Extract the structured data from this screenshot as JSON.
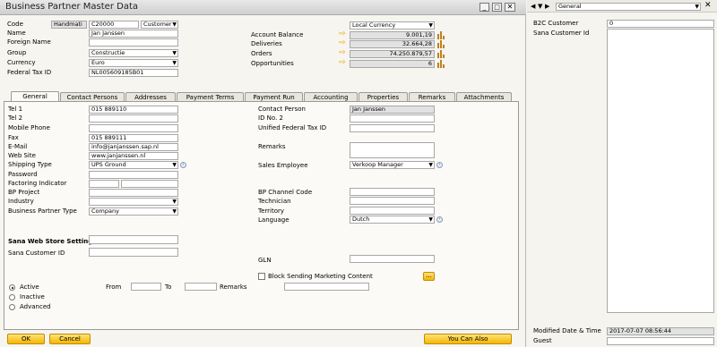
{
  "window": {
    "title": "Business Partner Master Data"
  },
  "header": {
    "code_label": "Code",
    "code_series": "Handmati",
    "code_value": "C20000",
    "code_type": "Customer",
    "name_label": "Name",
    "name_value": "Jan Janssen",
    "foreign_name_label": "Foreign Name",
    "foreign_name_value": "",
    "group_label": "Group",
    "group_value": "Constructie",
    "currency_label": "Currency",
    "currency_value": "Euro",
    "federal_tax_label": "Federal Tax ID",
    "federal_tax_value": "NL005609185B01",
    "local_currency": "Local Currency",
    "balance_label": "Account Balance",
    "balance_value": "9.001,19",
    "deliveries_label": "Deliveries",
    "deliveries_value": "32.664,28",
    "orders_label": "Orders",
    "orders_value": "74.250.879,57",
    "opportunities_label": "Opportunities",
    "opportunities_value": "6"
  },
  "tabs": [
    "General",
    "Contact Persons",
    "Addresses",
    "Payment Terms",
    "Payment Run",
    "Accounting",
    "Properties",
    "Remarks",
    "Attachments"
  ],
  "general": {
    "tel1_label": "Tel 1",
    "tel1_value": "015 889110",
    "tel2_label": "Tel 2",
    "tel2_value": "",
    "mobile_label": "Mobile Phone",
    "mobile_value": "",
    "fax_label": "Fax",
    "fax_value": "015 889111",
    "email_label": "E-Mail",
    "email_value": "info@janjanssen.sap.nl",
    "website_label": "Web Site",
    "website_value": "www.janjanssen.nl",
    "shipping_label": "Shipping Type",
    "shipping_value": "UPS Ground",
    "password_label": "Password",
    "password_value": "",
    "factoring_label": "Factoring Indicator",
    "bp_project_label": "BP Project",
    "industry_label": "Industry",
    "bp_type_label": "Business Partner Type",
    "bp_type_value": "Company",
    "contact_person_label": "Contact Person",
    "contact_person_value": "Jan Janssen",
    "id_no2_label": "ID No. 2",
    "unified_tax_label": "Unified Federal Tax ID",
    "remarks_label": "Remarks",
    "sales_employee_label": "Sales Employee",
    "sales_employee_value": "Verkoop Manager",
    "bp_channel_label": "BP Channel Code",
    "technician_label": "Technician",
    "territory_label": "Territory",
    "language_label": "Language",
    "language_value": "Dutch",
    "sana_web_label": "Sana Web Store Settings",
    "sana_customer_label": "Sana Customer ID",
    "gln_label": "GLN",
    "block_label": "Block Sending Marketing Content",
    "active_label": "Active",
    "inactive_label": "Inactive",
    "advanced_label": "Advanced",
    "from_label": "From",
    "to_label": "To",
    "remarks2_label": "Remarks",
    "ellipsis": "..."
  },
  "buttons": {
    "ok": "OK",
    "cancel": "Cancel",
    "you_can_also": "You Can Also"
  },
  "side_panel": {
    "select_value": "General",
    "b2c_label": "B2C Customer",
    "b2c_value": "0",
    "sana_id_label": "Sana Customer Id",
    "modified_label": "Modified Date & Time",
    "modified_value": "2017-07-07 08:56:44",
    "guest_label": "Guest"
  }
}
